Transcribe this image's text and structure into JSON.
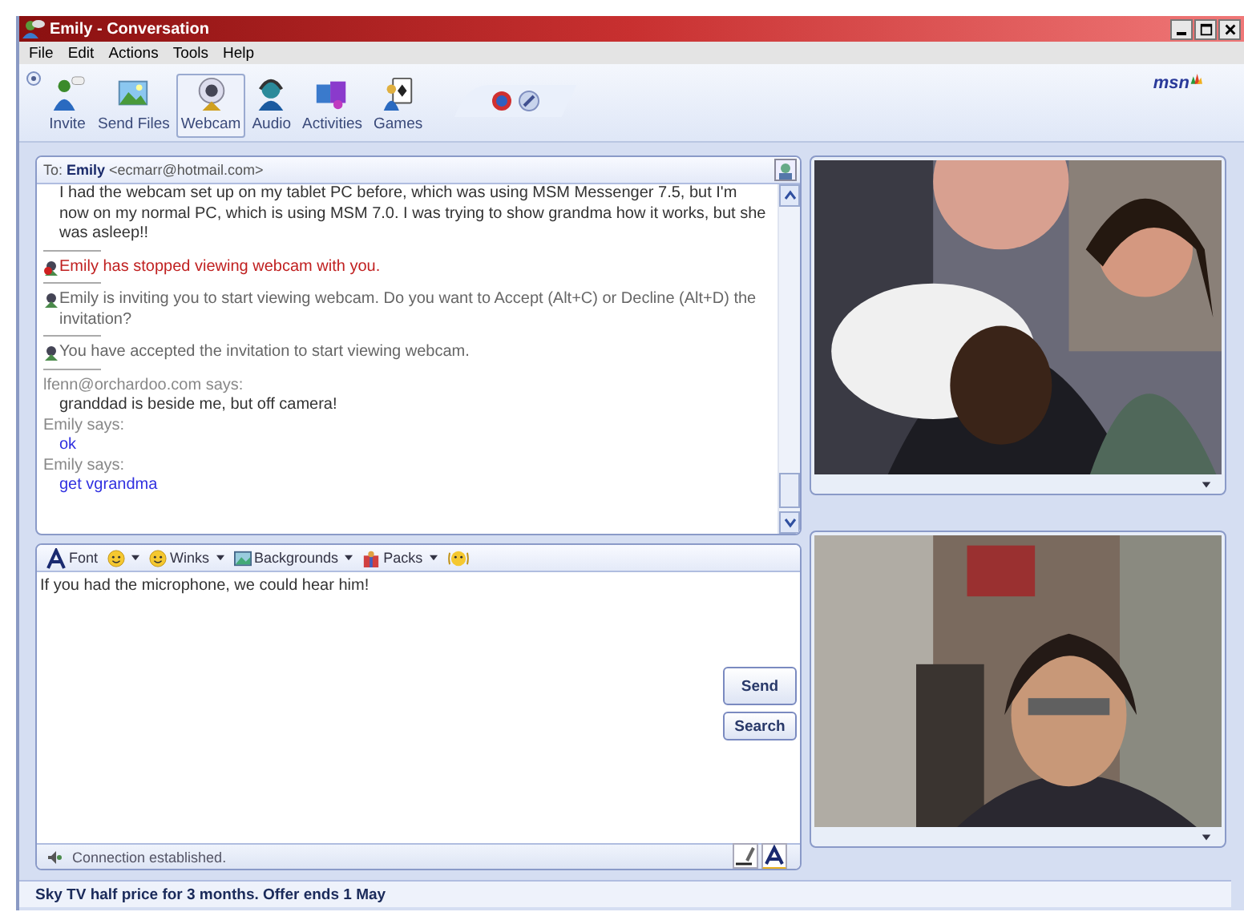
{
  "window": {
    "title": "Emily - Conversation"
  },
  "menu": [
    "File",
    "Edit",
    "Actions",
    "Tools",
    "Help"
  ],
  "toolbar": [
    {
      "label": "Invite",
      "selected": false
    },
    {
      "label": "Send Files",
      "selected": false
    },
    {
      "label": "Webcam",
      "selected": true
    },
    {
      "label": "Audio",
      "selected": false
    },
    {
      "label": "Activities",
      "selected": false
    },
    {
      "label": "Games",
      "selected": false
    }
  ],
  "logo": "msn",
  "to": {
    "label": "To:",
    "name": "Emily",
    "email": "<ecmarr@hotmail.com>"
  },
  "messages": [
    {
      "kind": "continuation",
      "text": "I had the webcam set up on my tablet PC before, which was using MSM Messenger 7.5, but I'm now on my normal PC, which is using MSM 7.0. I was trying to show grandma how it works, but she was asleep!!"
    },
    {
      "kind": "notice",
      "alert": true,
      "text": "Emily has stopped viewing webcam with you."
    },
    {
      "kind": "notice",
      "alert": false,
      "text": "Emily is inviting you to start viewing webcam. Do you want to Accept (Alt+C) or Decline (Alt+D) the invitation?"
    },
    {
      "kind": "notice",
      "alert": false,
      "text": "You have accepted the invitation to start viewing webcam."
    },
    {
      "kind": "says",
      "text": "lfenn@orchardoo.com says:"
    },
    {
      "kind": "reply",
      "self": true,
      "text": "granddad is beside me, but off camera!"
    },
    {
      "kind": "says",
      "text": "Emily says:"
    },
    {
      "kind": "reply",
      "self": false,
      "text": "ok"
    },
    {
      "kind": "says",
      "text": "Emily says:"
    },
    {
      "kind": "reply",
      "self": false,
      "text": "get vgrandma"
    }
  ],
  "format_bar": [
    "Font",
    "Winks",
    "Backgrounds",
    "Packs"
  ],
  "compose": {
    "value": "If you had the microphone, we could hear him!"
  },
  "buttons": [
    "Send",
    "Search"
  ],
  "connection_status": "Connection established.",
  "ad_bar": "Sky TV half price for 3 months. Offer ends 1 May"
}
